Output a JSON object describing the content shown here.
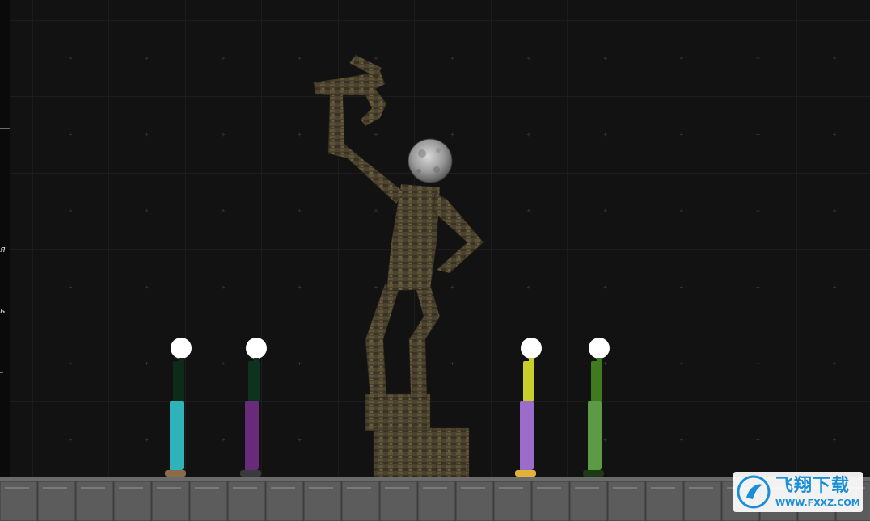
{
  "side_labels": [
    "я",
    "ь"
  ],
  "watermark": {
    "cn": "飞翔下载",
    "url": "WWW.FXXZ.COM"
  },
  "colors": {
    "background": "#121212",
    "grid": "#2a2a2a",
    "floor": "#5a5a5a",
    "stone": "#4d4530",
    "moon": "#a8a8a8"
  },
  "characters": [
    {
      "id": "ragdoll-1",
      "shirt": "#0e2a1b",
      "pants": "#2fb3b8",
      "shoes": "#8a6a4a"
    },
    {
      "id": "ragdoll-2",
      "shirt": "#0d3320",
      "pants": "#6a2a7a",
      "shoes": "#3a3a3a"
    },
    {
      "id": "ragdoll-3",
      "shirt": "#c8cf2a",
      "pants": "#9b6cc9",
      "shoes": "#e0b23a"
    },
    {
      "id": "ragdoll-4",
      "shirt": "#3f7a1e",
      "pants": "#5d9a46",
      "shoes": "#1e3a14"
    }
  ]
}
